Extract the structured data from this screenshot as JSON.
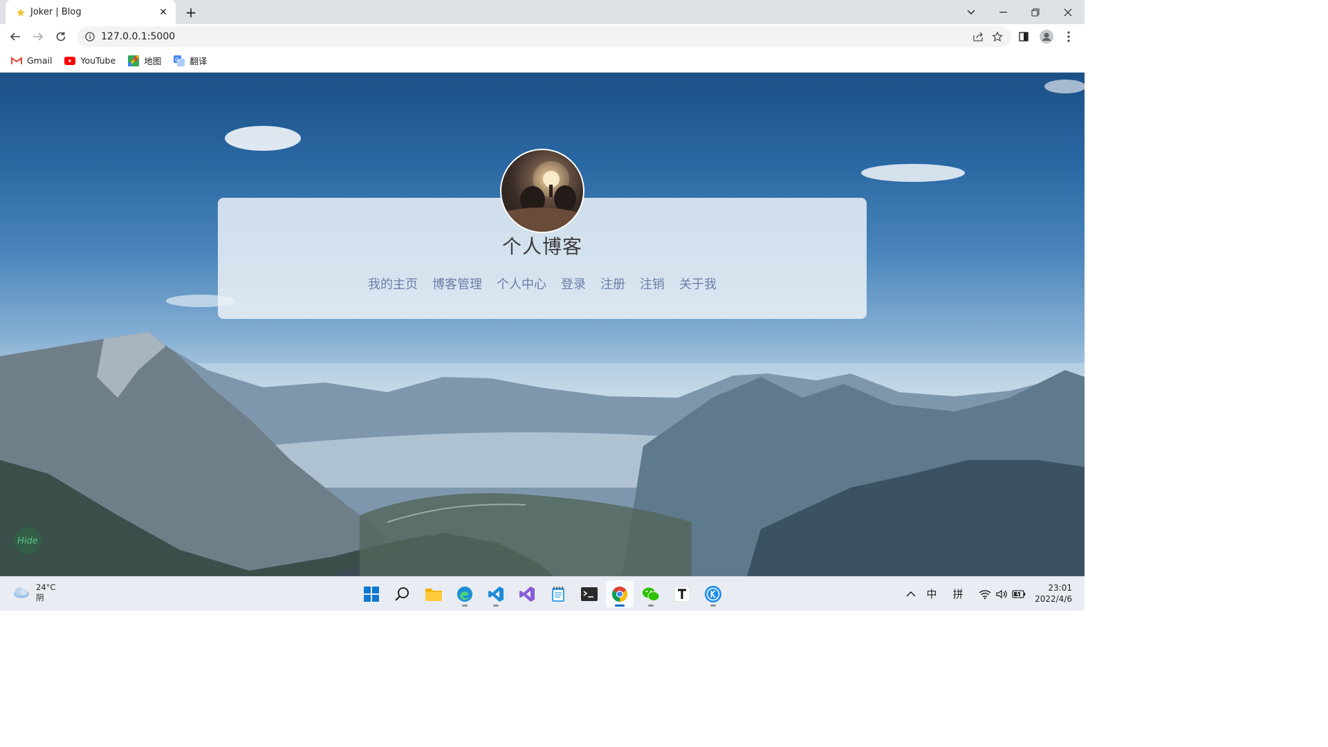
{
  "browser": {
    "tab_title": "Joker | Blog",
    "url": "127.0.0.1:5000",
    "bookmarks": [
      {
        "label": "Gmail",
        "icon": "gmail-icon"
      },
      {
        "label": "YouTube",
        "icon": "youtube-icon"
      },
      {
        "label": "地图",
        "icon": "maps-icon"
      },
      {
        "label": "翻译",
        "icon": "translate-icon"
      }
    ]
  },
  "page": {
    "title": "个人博客",
    "nav": [
      "我的主页",
      "博客管理",
      "个人中心",
      "登录",
      "注册",
      "注销",
      "关于我"
    ],
    "hide_button": "Hide"
  },
  "taskbar": {
    "weather_temp": "24°C",
    "weather_condition": "阴",
    "apps": [
      "start-icon",
      "search-icon",
      "file-explorer-icon",
      "edge-icon",
      "vscode-icon",
      "visual-studio-icon",
      "notepad-icon",
      "terminal-icon",
      "chrome-icon",
      "wechat-icon",
      "typora-icon",
      "kugou-icon"
    ],
    "ime_lang": "中",
    "ime_mode": "拼",
    "time": "23:01",
    "date": "2022/4/6"
  },
  "colors": {
    "nav_link": "#6a7fa8",
    "title_text": "#3b3b3b",
    "card_bg": "rgba(238,243,248,0.84)",
    "taskbar_bg": "#e9edf3"
  }
}
